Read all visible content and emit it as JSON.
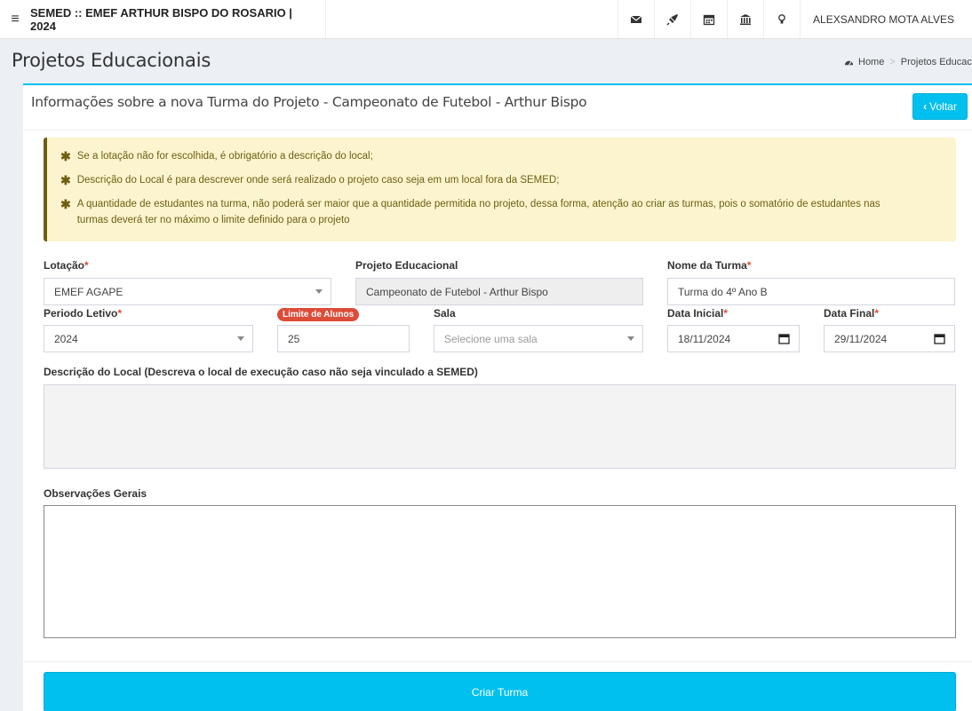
{
  "header": {
    "brand": "SEMED :: EMEF ARTHUR BISPO DO ROSARIO | 2024",
    "user_name": "ALEXSANDRO MOTA ALVES",
    "icons": [
      "envelope-icon",
      "rocket-icon",
      "calendar-icon",
      "bank-icon",
      "lightbulb-icon"
    ]
  },
  "page": {
    "title": "Projetos Educacionais",
    "breadcrumb": [
      "Home",
      "Projetos Educacio"
    ]
  },
  "box": {
    "title": "Informações sobre a nova Turma do Projeto - Campeonato de Futebol - Arthur Bispo",
    "back_label": "Voltar",
    "notes": [
      "Se a lotação não for escolhida, é obrigatório a descrição do local;",
      "Descrição do Local é para descrever onde será realizado o projeto caso seja em um local fora da SEMED;",
      "A quantidade de estudantes na turma, não poderá ser maior que a quantidade permitida no projeto, dessa forma, atenção ao criar as turmas, pois o somatório de estudantes nas turmas deverá ter no máximo o limite definido para o projeto"
    ]
  },
  "form": {
    "lotacao": {
      "label": "Lotação",
      "value": "EMEF AGAPE"
    },
    "projeto": {
      "label": "Projeto Educacional",
      "value": "Campeonato de Futebol - Arthur Bispo"
    },
    "nome_turma": {
      "label": "Nome da Turma",
      "value": "Turma do 4º Ano B"
    },
    "periodo": {
      "label": "Periodo Letivo",
      "value": "2024"
    },
    "limite": {
      "badge": "Limite de Alunos",
      "value": "25"
    },
    "sala": {
      "label": "Sala",
      "placeholder": "Selecione uma sala"
    },
    "data_inicial": {
      "label": "Data Inicial",
      "value": "18/11/2024"
    },
    "data_final": {
      "label": "Data Final",
      "value": "29/11/2024"
    },
    "descricao": {
      "label": "Descrição do Local  (Descreva o local de execução caso não seja vinculado a SEMED)",
      "value": ""
    },
    "observacoes": {
      "label": "Observações Gerais",
      "value": ""
    },
    "required_mark": "*",
    "submit_label": "Criar Turma"
  },
  "colors": {
    "accent": "#00c0ef",
    "required": "#dd4b39",
    "callout_bg": "#fcf4ce",
    "callout_text": "#6d5f12"
  }
}
